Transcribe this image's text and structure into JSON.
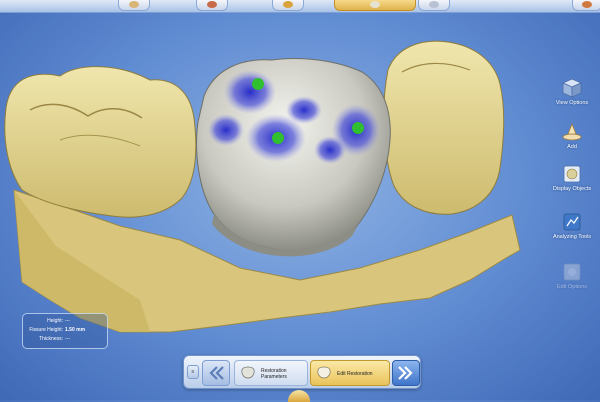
{
  "top_tabs": [
    {
      "name": "tab-1",
      "active": false,
      "color": "#d9b57a"
    },
    {
      "name": "tab-2",
      "active": false,
      "color": "#c96a4a"
    },
    {
      "name": "tab-3",
      "active": false,
      "color": "#d8a33a"
    },
    {
      "name": "tab-4",
      "active": true,
      "color": "#e6e2d2"
    },
    {
      "name": "tab-5",
      "active": false,
      "color": "#b8c2d4"
    },
    {
      "name": "tab-6",
      "active": false,
      "color": "#d07a42"
    }
  ],
  "tools": {
    "view_options": {
      "label": "View Options",
      "icon": "cube-icon"
    },
    "add": {
      "label": "Add",
      "icon": "add-material-icon"
    },
    "display_objects": {
      "label": "Display Objects",
      "icon": "display-objects-icon"
    },
    "analyzing_tools": {
      "label": "Analyzing Tools",
      "icon": "analyzing-tools-icon"
    },
    "edit_options": {
      "label": "Edit Options",
      "icon": "edit-options-icon",
      "enabled": false
    }
  },
  "measurements": {
    "height_label": "Height:",
    "height_value": "---",
    "fissure_label": "Fissure Height:",
    "fissure_value": "1.50 mm",
    "thickness_label": "Thickness:",
    "thickness_value": "---"
  },
  "wizard": {
    "small_button": "≡",
    "back_icon": "double-chevron-left-icon",
    "steps": [
      {
        "label": "Restoration Parameters",
        "active": false
      },
      {
        "label": "Edit Restoration",
        "active": true
      }
    ],
    "forward_icon": "double-chevron-right-icon"
  },
  "colors": {
    "model": "#e8dc9a",
    "crown": "#c8c8c3",
    "contact_blue": "#3b3fd6",
    "contact_green": "#2fbf2f"
  }
}
